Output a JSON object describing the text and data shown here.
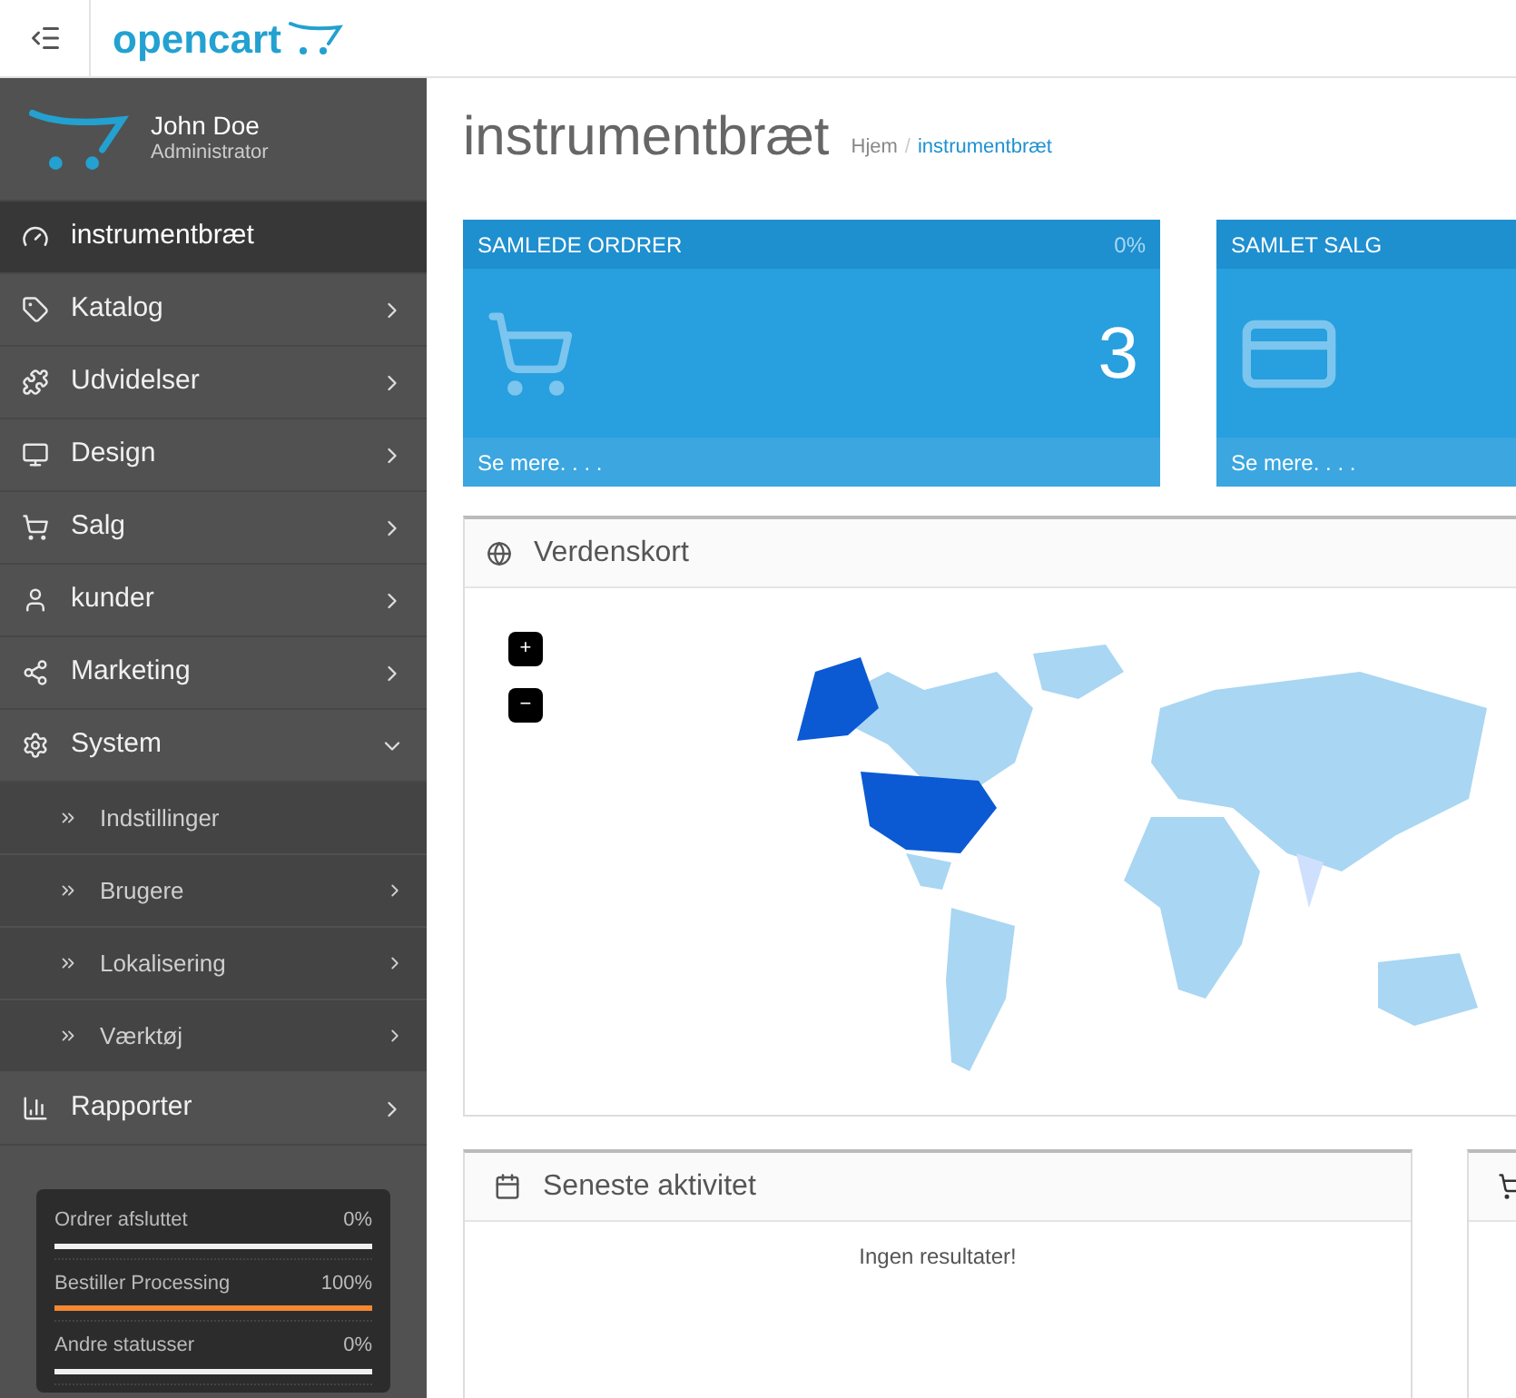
{
  "header": {
    "logo": "opencart"
  },
  "profile": {
    "name": "John Doe",
    "role": "Administrator"
  },
  "menu": [
    {
      "label": "instrumentbræt",
      "kind": "link",
      "selected": true
    },
    {
      "label": "Katalog",
      "kind": "group",
      "selected": false,
      "expanded": false
    },
    {
      "label": "Udvidelser",
      "kind": "group",
      "selected": false,
      "expanded": false
    },
    {
      "label": "Design",
      "kind": "group",
      "selected": false,
      "expanded": false
    },
    {
      "label": "Salg",
      "kind": "group",
      "selected": false,
      "expanded": false
    },
    {
      "label": "kunder",
      "kind": "group",
      "selected": false,
      "expanded": false
    },
    {
      "label": "Marketing",
      "kind": "group",
      "selected": false,
      "expanded": false
    },
    {
      "label": "System",
      "kind": "group",
      "selected": false,
      "expanded": true,
      "children": [
        {
          "label": "Indstillinger",
          "kind": "link"
        },
        {
          "label": "Brugere",
          "kind": "group"
        },
        {
          "label": "Lokalisering",
          "kind": "group"
        },
        {
          "label": "Værktøj",
          "kind": "group"
        }
      ]
    },
    {
      "label": "Rapporter",
      "kind": "group",
      "selected": false,
      "expanded": false
    }
  ],
  "order_status": [
    {
      "label": "Ordrer afsluttet",
      "reading": "0%",
      "color": "#f0f0f0"
    },
    {
      "label": "Bestiller Processing",
      "reading": "100%",
      "color": "#f38733"
    },
    {
      "label": "Andre statusser",
      "reading": "0%",
      "color": "#f0f0f0"
    }
  ],
  "page": {
    "title": "instrumentbræt",
    "breadcrumb": [
      "Hjem",
      "instrumentbræt"
    ],
    "breadcrumb_separator": "/"
  },
  "tiles": [
    {
      "title": "SAMLEDE ORDRER",
      "percent": "0%",
      "value": "3",
      "link": "Se mere. . . ."
    },
    {
      "title": "SAMLET SALG",
      "link": "Se mere. . . ."
    }
  ],
  "map_panel": {
    "title": "Verdenskort",
    "zoom_in": "+",
    "zoom_out": "−"
  },
  "activity_panel": {
    "title": "Seneste aktivitet",
    "empty": "Ingen resultater!"
  }
}
